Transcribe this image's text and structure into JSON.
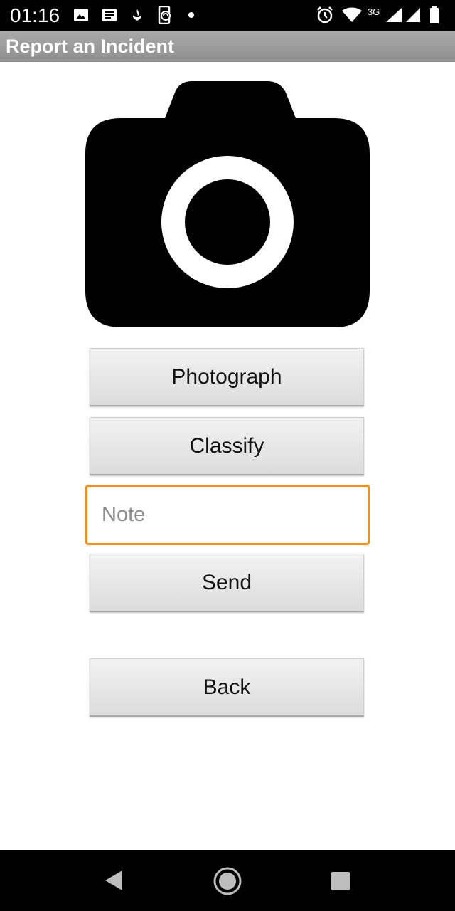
{
  "status_bar": {
    "time": "01:16",
    "network": "3G",
    "left_icons": [
      "image-icon",
      "message-icon",
      "bank-icon",
      "phone-sync-icon",
      "dot-icon"
    ],
    "right_icons": [
      "alarm-icon",
      "wifi-icon",
      "signal-icon",
      "signal-icon",
      "battery-icon"
    ]
  },
  "header": {
    "title": "Report an Incident"
  },
  "main": {
    "camera_icon": "camera-icon",
    "photograph_label": "Photograph",
    "classify_label": "Classify",
    "note": {
      "value": "",
      "placeholder": "Note"
    },
    "send_label": "Send",
    "back_label": "Back"
  },
  "nav_bar": {
    "icons": [
      "back-triangle-icon",
      "home-circle-icon",
      "recents-square-icon"
    ]
  },
  "colors": {
    "title_bar": "#999999",
    "note_focus_border": "#f0901e",
    "button_bg": "#e6e6e6"
  }
}
